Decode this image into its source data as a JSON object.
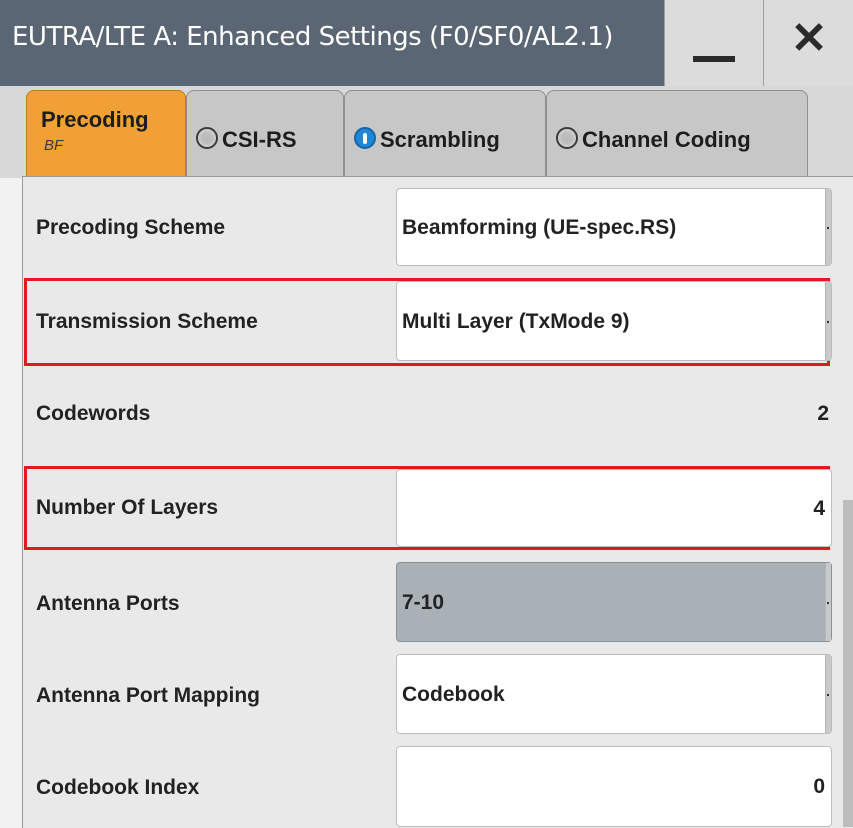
{
  "window": {
    "title": "EUTRA/LTE A: Enhanced Settings (F0/SF0/AL2.1)"
  },
  "tabs": [
    {
      "label": "Precoding",
      "sublabel": "BF",
      "active": true
    },
    {
      "label": "CSI-RS",
      "indicator": "off"
    },
    {
      "label": "Scrambling",
      "indicator": "on"
    },
    {
      "label": "Channel Coding",
      "indicator": "off"
    }
  ],
  "rows": {
    "precoding_scheme": {
      "label": "Precoding Scheme",
      "value": "Beamforming (UE-spec.RS)"
    },
    "transmission_scheme": {
      "label": "Transmission Scheme",
      "value": "Multi Layer (TxMode 9)"
    },
    "codewords": {
      "label": "Codewords",
      "value": "2"
    },
    "number_of_layers": {
      "label": "Number Of Layers",
      "value": "4"
    },
    "antenna_ports": {
      "label": "Antenna Ports",
      "value": "7-10"
    },
    "antenna_port_mapping": {
      "label": "Antenna Port Mapping",
      "value": "Codebook"
    },
    "codebook_index": {
      "label": "Codebook Index",
      "value": "0"
    }
  },
  "colors": {
    "active_tab": "#f1a133",
    "highlight": "#e11b1b",
    "indicator_on": "#1e87d8",
    "titlebar": "#5a6674"
  },
  "icons": {
    "minimize": "minimize-icon",
    "close": "close-icon",
    "indicator_on": "info-indicator-icon",
    "indicator_off": "inactive-indicator-icon"
  }
}
